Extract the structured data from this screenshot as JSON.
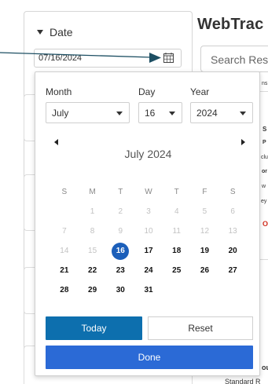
{
  "app": {
    "title": "WebTrac"
  },
  "search": {
    "placeholder": "Search Results"
  },
  "filter": {
    "heading": "Date",
    "value": "07/16/2024"
  },
  "background_fragments": [
    "ns",
    "S",
    "P",
    "clu",
    "or",
    "w",
    "ey",
    "O",
    "ou",
    "Standard R"
  ],
  "datepicker": {
    "month_label": "Month",
    "day_label": "Day",
    "year_label": "Year",
    "month_value": "July",
    "day_value": "16",
    "year_value": "2024",
    "caption": "July 2024",
    "weekdays": [
      "S",
      "M",
      "T",
      "W",
      "T",
      "F",
      "S"
    ],
    "weeks": [
      [
        "",
        "1",
        "2",
        "3",
        "4",
        "5",
        "6"
      ],
      [
        "7",
        "8",
        "9",
        "10",
        "11",
        "12",
        "13"
      ],
      [
        "14",
        "15",
        "16",
        "17",
        "18",
        "19",
        "20"
      ],
      [
        "21",
        "22",
        "23",
        "24",
        "25",
        "26",
        "27"
      ],
      [
        "28",
        "29",
        "30",
        "31",
        "",
        "",
        ""
      ]
    ],
    "selected_day": "16",
    "first_available_day": "16",
    "today_label": "Today",
    "reset_label": "Reset",
    "done_label": "Done"
  },
  "colors": {
    "selected_day": "#1c5fba",
    "today_button": "#0d6fae",
    "done_button": "#2b6ad6",
    "callout_arrow": "#1d4f63",
    "alert_text": "#d12e1f"
  },
  "icons": [
    "calendar-icon",
    "chevron-down-icon",
    "chevron-left-icon",
    "chevron-right-icon",
    "arrow-pointer-icon"
  ]
}
